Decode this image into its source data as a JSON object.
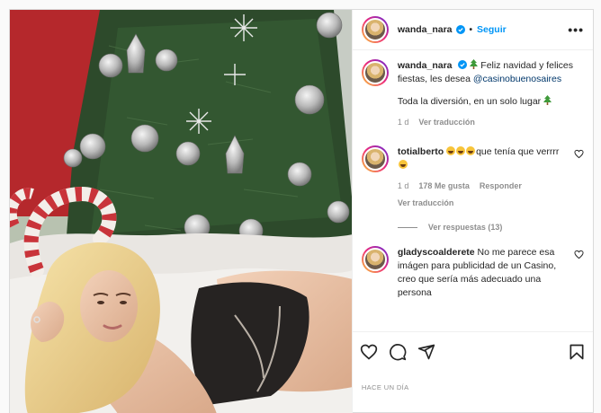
{
  "colors": {
    "link": "#0095f6",
    "mention": "#00376b",
    "muted": "#8e8e8e",
    "border": "#dbdbdb"
  },
  "header": {
    "username": "wanda_nara",
    "separator": "•",
    "follow_label": "Seguir",
    "more_icon": "ellipsis-icon",
    "more_label": "•••"
  },
  "caption": {
    "username": "wanda_nara",
    "text_1": "Feliz navidad y felices fiestas, les desea",
    "mention": "@casinobuenosaires",
    "text_2": "Toda la diversión, en un solo lugar",
    "time": "1 d",
    "translate": "Ver traducción"
  },
  "comments": [
    {
      "username": "totialberto",
      "text": "que tenía que verrrr",
      "time": "1 d",
      "likes": "178 Me gusta",
      "reply": "Responder",
      "translate": "Ver traducción",
      "replies_label": "Ver respuestas (13)"
    },
    {
      "username": "gladyscoalderete",
      "text": "No me parece esa imágen para publicidad de un Casino, creo que sería más adecuado una persona"
    }
  ],
  "actions": {
    "like_icon": "heart-icon",
    "comment_icon": "comment-icon",
    "share_icon": "send-icon",
    "save_icon": "bookmark-icon"
  },
  "date": "HACE UN DÍA"
}
